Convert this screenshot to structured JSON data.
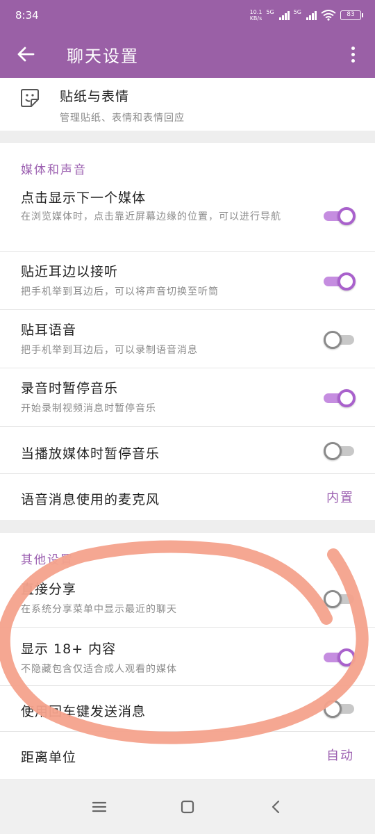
{
  "status_bar": {
    "time": "8:34",
    "net_speed_value": "10.1",
    "net_speed_unit": "KB/s",
    "sim1": "5G",
    "sim2": "5G",
    "battery": "83"
  },
  "app_bar": {
    "title": "聊天设置"
  },
  "sticker_row": {
    "title": "贴纸与表情",
    "subtitle": "管理贴纸、表情和表情回应"
  },
  "media_section": {
    "title": "媒体和声音",
    "items": [
      {
        "title": "点击显示下一个媒体",
        "subtitle": "在浏览媒体时，点击靠近屏幕边缘的位置，可以进行导航",
        "toggle": true
      },
      {
        "title": "贴近耳边以接听",
        "subtitle": "把手机举到耳边后，可以将声音切换至听筒",
        "toggle": true
      },
      {
        "title": "贴耳语音",
        "subtitle": "把手机举到耳边后，可以录制语音消息",
        "toggle": false
      },
      {
        "title": "录音时暂停音乐",
        "subtitle": "开始录制视频消息时暂停音乐",
        "toggle": true
      },
      {
        "title": "当播放媒体时暂停音乐",
        "toggle": false
      },
      {
        "title": "语音消息使用的麦克风",
        "value": "内置"
      }
    ]
  },
  "other_section": {
    "title": "其他设置",
    "items": [
      {
        "title": "直接分享",
        "subtitle": "在系统分享菜单中显示最近的聊天",
        "toggle": false
      },
      {
        "title": "显示 18+ 内容",
        "subtitle": "不隐藏包含仅适合成人观看的媒体",
        "toggle": true
      },
      {
        "title": "使用回车键发送消息",
        "toggle": false
      },
      {
        "title": "距离单位",
        "value": "自动"
      }
    ]
  },
  "colors": {
    "accent": "#9a60a6",
    "toggle_on": "#a961cc",
    "annotation": "#f4a28c"
  }
}
